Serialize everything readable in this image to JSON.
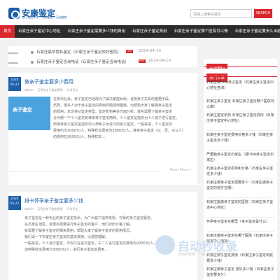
{
  "header": {
    "logo_title": "安康鉴定",
    "logo_subtitle": "亲子鉴定中心 · 司法鉴定 · 无创鉴定",
    "search_placeholder": "请输入搜索关键字",
    "search_button": "SEARCH"
  },
  "nav": {
    "items": [
      "首页",
      "石家庄亲子鉴定中心地址",
      "石家庄亲子鉴定需要多少钱的费用",
      "石家庄亲子鉴定费用",
      "石家庄亲子鉴定哪个医院可以做",
      "石家庄亲子鉴定要多久出结果"
    ]
  },
  "topnews": [
    {
      "text": "石家庄最早隐私鉴定（石家庄亲子鉴定较好医院）",
      "hot": "HOT",
      "date": "2024-04-10"
    },
    {
      "text": "石家庄亲子鉴定咨询电话（石家庄亲子鉴定咨询电话）",
      "hot": "HOT",
      "date": "2024-04-10"
    }
  ],
  "articles": [
    {
      "year": "2024",
      "day": "05-27",
      "title": "做亲子鉴定要多少费用",
      "meta": [
        "admin",
        "石家庄亲子鉴定费用",
        "0 条评论"
      ],
      "thumb": "亲子鉴定",
      "body": [
        "在现代社会，亲子鉴定已经成为了解决家庭纠纷、证明亲子关系的重要手段。",
        "然而，很多人对于亲子鉴定的费用问题感到困惑。为帮助大家了解做亲子鉴定",
        "的费用，本文将从鉴定类型、鉴定机构等多方面分析。首先需要了解亲子鉴定",
        "分为哪一下个人鉴定和准亲亲子鉴定两种。个人鉴定是指仅为个人孩子进行鉴定，",
        "而准亲亲子鉴定是指仅仅父母和子女进行的亲子鉴定。一般来说，个人鉴定的",
        "费用约为2000元/人，特殊样本费用为3000元/人，准亲亲子鉴定（父、母、子三人）",
        "的费用在2000元/人，特殊样本..."
      ],
      "readmore": "Read More »"
    },
    {
      "year": "2024",
      "day": "05-27",
      "title": "排卡怀孕亲子鉴定要多少钱",
      "meta": [
        "admin",
        "石家庄亲子鉴定费用",
        "0 条评论"
      ],
      "body": [
        "亲子鉴定是一种专业的亲子鉴定技术，为广大客户提供亲情、可靠的亲子鉴定服务。",
        "在石家庄地区，有很多需要进行亲子鉴定的客户，他们对比价格了解，",
        "有需要了解亲子鉴定的相关费用，帮助大家了解亲子鉴定的费用情况。",
        "我们请一下石家庄亲子鉴定的基本费用，以便您理解。",
        "一般来说，个人进行鉴定，不仅只在进行鉴定，子二人进行鉴定的费用为2000元/人，",
        "加特殊样本费用为3000元/人，进行亲子鉴定的费用..."
      ]
    }
  ],
  "sidebar": {
    "box1_head": "在线预约",
    "box2_head": "热门文章",
    "items": [
      "石家庄做DNA亲子鉴定（石家庄亲子鉴定中心地址查询）",
      "石家庄亲子鉴定 石家庄亲子鉴定哪个医院可以做）",
      "石家庄鉴定机构 石家庄亲子鉴定机构（石家庄亲子鉴定中心地址）",
      "石家庄亲子鉴定费用价格多少钱（石家庄亲子鉴定多少钱）",
      "严重胎亲子鉴定石家庄（排DNA亲子鉴定石家庄）",
      "石家庄亲子鉴定机构和价格（石家庄亲子鉴定多少钱）",
      "石家庄做亲子鉴定需要多少（石家庄做亲子鉴定的地方在哪）",
      "石家庄能做亲子鉴定的医院（石家庄亲子鉴定中心地址）",
      "怀孕亲子鉴定在哪里（亲子鉴定是什么）",
      "石家庄做亲子鉴定在哪个医院（石家庄亲子鉴定中心地址）",
      "石家庄亲子鉴定费用（石家庄亲子鉴定到底要多少钱）",
      "石家庄做亲子鉴定 排队多少钱（石家庄亲子鉴定要多久）"
    ]
  },
  "watermark": {
    "title": "自动秒收录",
    "sub": "自动秒收录 · 一键 · 网站收录"
  },
  "colors": {
    "accent": "#d9272e",
    "brand": "#1a5fa8",
    "nav_bg": "#2b2b2b"
  }
}
